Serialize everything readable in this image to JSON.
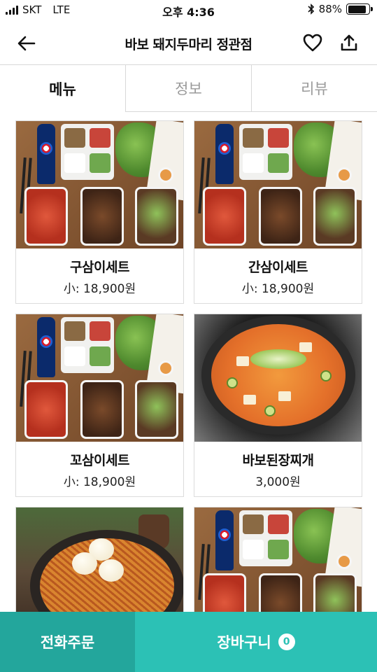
{
  "status_bar": {
    "carrier": "SKT",
    "network": "LTE",
    "time": "오후 4:36",
    "battery": "88%",
    "battery_level": 0.88
  },
  "header": {
    "title": "바보 돼지두마리 정관점",
    "icons": {
      "back": "back-arrow-icon",
      "favorite": "heart-icon",
      "share": "share-icon"
    }
  },
  "tabs": [
    {
      "label": "메뉴",
      "active": true
    },
    {
      "label": "정보",
      "active": false
    },
    {
      "label": "리뷰",
      "active": false
    }
  ],
  "menu": [
    {
      "name": "구삼이세트",
      "price": "小: 18,900원",
      "photo": "set-meal"
    },
    {
      "name": "간삼이세트",
      "price": "小: 18,900원",
      "photo": "set-meal"
    },
    {
      "name": "꼬삼이세트",
      "price": "小: 18,900원",
      "photo": "set-meal"
    },
    {
      "name": "바보된장찌개",
      "price": "3,000원",
      "photo": "soybean-stew"
    },
    {
      "name": "",
      "price": "",
      "photo": "ramen"
    },
    {
      "name": "",
      "price": "",
      "photo": "set-meal"
    }
  ],
  "bottom_bar": {
    "phone_order": "전화주문",
    "cart": "장바구니",
    "cart_count": "0"
  },
  "colors": {
    "phone_order_bg": "#23a69c",
    "cart_bg": "#2cc1b5"
  }
}
